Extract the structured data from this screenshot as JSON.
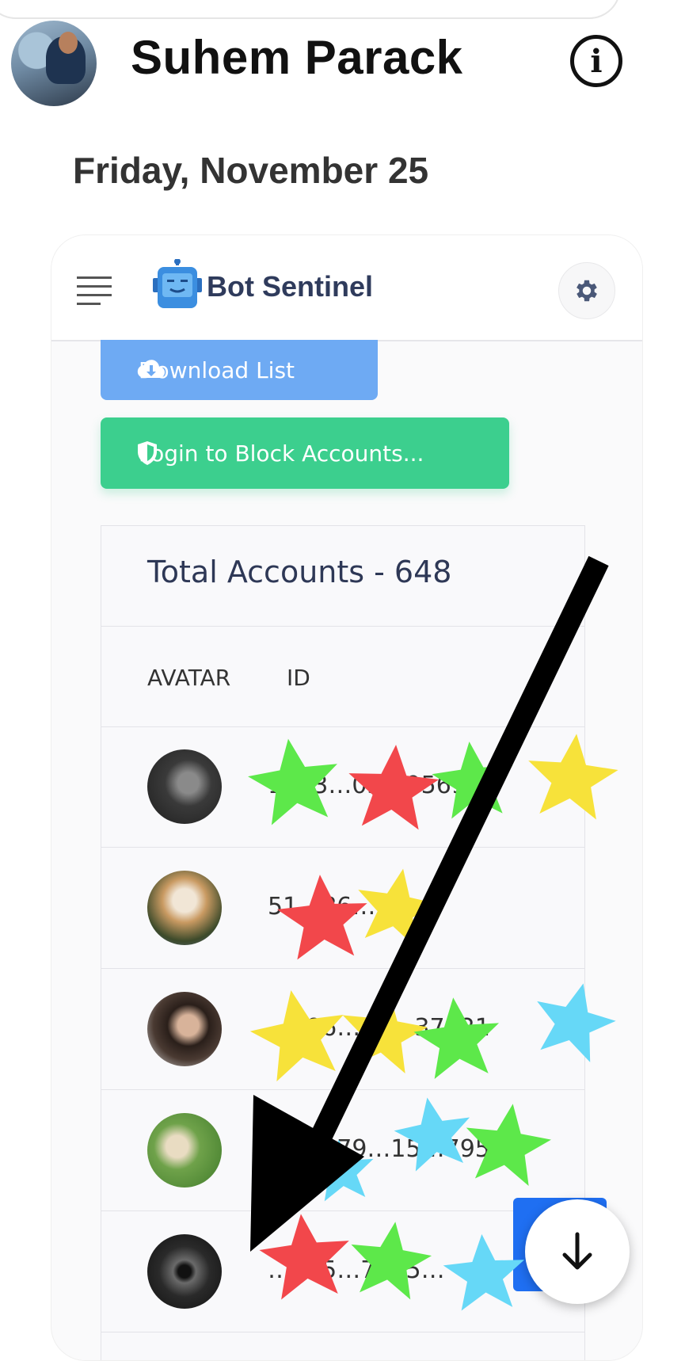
{
  "thread": {
    "user_name": "Suhem Parack",
    "date": "Friday, November 25"
  },
  "app": {
    "brand": "Bot Sentinel",
    "download_button": "Download List",
    "login_button": "Login to Block Accounts...",
    "table": {
      "title": "Total Accounts - 648",
      "columns": [
        "AVATAR",
        "ID"
      ],
      "rows": [
        {
          "id": "1493…05…9569"
        },
        {
          "id": "51…86…"
        },
        {
          "id": "…296…59…37921"
        },
        {
          "id": "…62479…15…7952"
        },
        {
          "id": "…935…7915…"
        }
      ]
    }
  },
  "icons": {
    "info": "info-circle-icon",
    "menu": "hamburger-menu-icon",
    "logo": "robot-logo-icon",
    "settings": "gear-icon",
    "download": "cloud-download-icon",
    "login": "shield-icon",
    "scroll": "arrow-down-icon"
  },
  "colors": {
    "download_button": "#6eaaf3",
    "login_button": "#3ccf8e",
    "brand_text": "#2f3b5c",
    "sticker_green": "#5de84a",
    "sticker_red": "#f2474b",
    "sticker_yellow": "#f7e23a",
    "sticker_blue": "#66d8f7"
  }
}
